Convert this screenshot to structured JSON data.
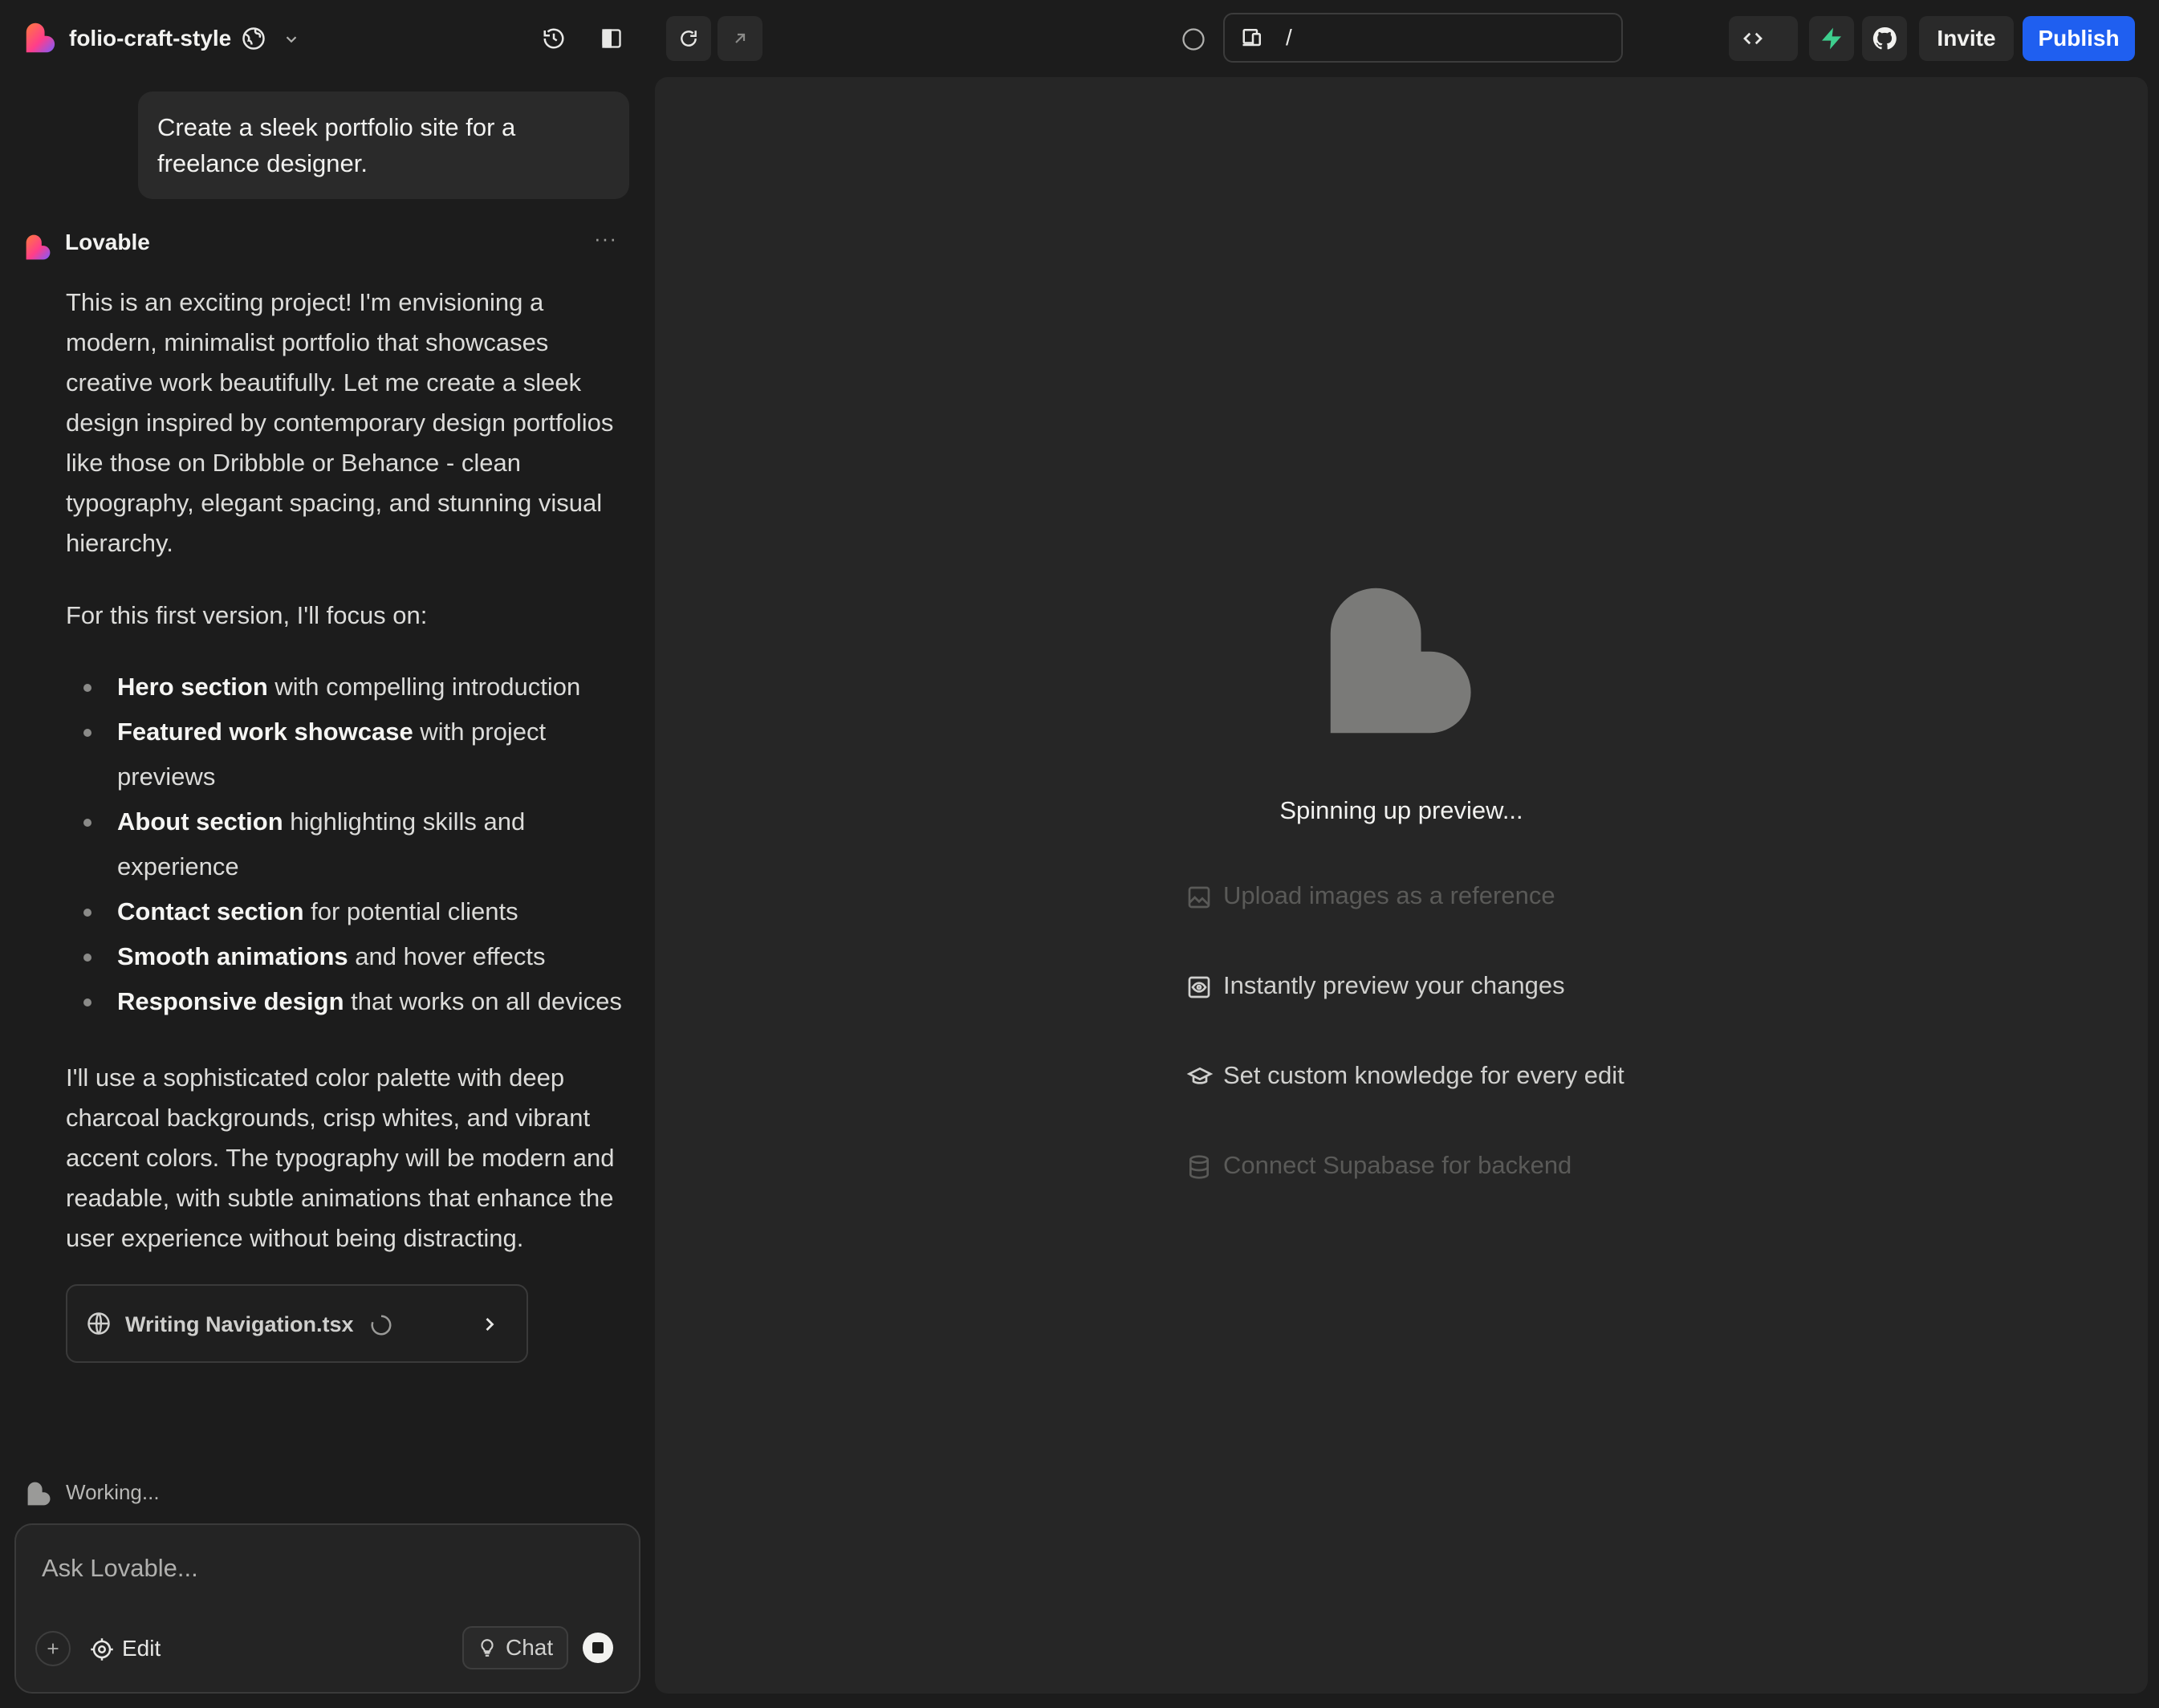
{
  "header": {
    "project_name": "folio-craft-style",
    "url_path": "/",
    "invite_label": "Invite",
    "publish_label": "Publish"
  },
  "chat": {
    "user_message": "Create a sleek portfolio site for a freelance designer.",
    "assistant_name": "Lovable",
    "more_label": "···",
    "paragraph1": "This is an exciting project! I'm envisioning a modern, minimalist portfolio that showcases creative work beautifully. Let me create a sleek design inspired by contemporary design portfolios like those on Dribbble or Behance - clean typography, elegant spacing, and stunning visual hierarchy.",
    "paragraph2": "For this first version, I'll focus on:",
    "bullets": [
      {
        "bold": "Hero section",
        "rest": " with compelling introduction"
      },
      {
        "bold": "Featured work showcase",
        "rest": " with project previews"
      },
      {
        "bold": "About section",
        "rest": " highlighting skills and experience"
      },
      {
        "bold": "Contact section",
        "rest": " for potential clients"
      },
      {
        "bold": "Smooth animations",
        "rest": " and hover effects"
      },
      {
        "bold": "Responsive design",
        "rest": " that works on all devices"
      }
    ],
    "paragraph3": "I'll use a sophisticated color palette with deep charcoal backgrounds, crisp whites, and vibrant accent colors. The typography will be modern and readable, with subtle animations that enhance the user experience without being distracting.",
    "file_status": "Writing Navigation.tsx",
    "working_label": "Working..."
  },
  "composer": {
    "placeholder": "Ask Lovable...",
    "edit_label": "Edit",
    "chat_label": "Chat"
  },
  "preview": {
    "status": "Spinning up preview...",
    "tips": [
      "Upload images as a reference",
      "Instantly preview your changes",
      "Set custom knowledge for every edit",
      "Connect Supabase for backend"
    ]
  },
  "colors": {
    "background": "#1c1c1c",
    "panel": "#262626",
    "accent_blue": "#1f5ff0",
    "supabase_green": "#3ecf8e",
    "logo_gradient": [
      "#ff3d8b",
      "#ff7a3d",
      "#7a5cff"
    ]
  },
  "icons": {
    "logo": "lovable-heart-icon",
    "visibility": "globe-icon",
    "history": "history-icon",
    "sidebar": "sidebar-toggle-icon",
    "refresh": "refresh-icon",
    "open_external": "arrow-up-right-icon",
    "device": "device-icon",
    "code": "code-icon",
    "supabase": "supabase-bolt-icon",
    "github": "github-icon"
  }
}
